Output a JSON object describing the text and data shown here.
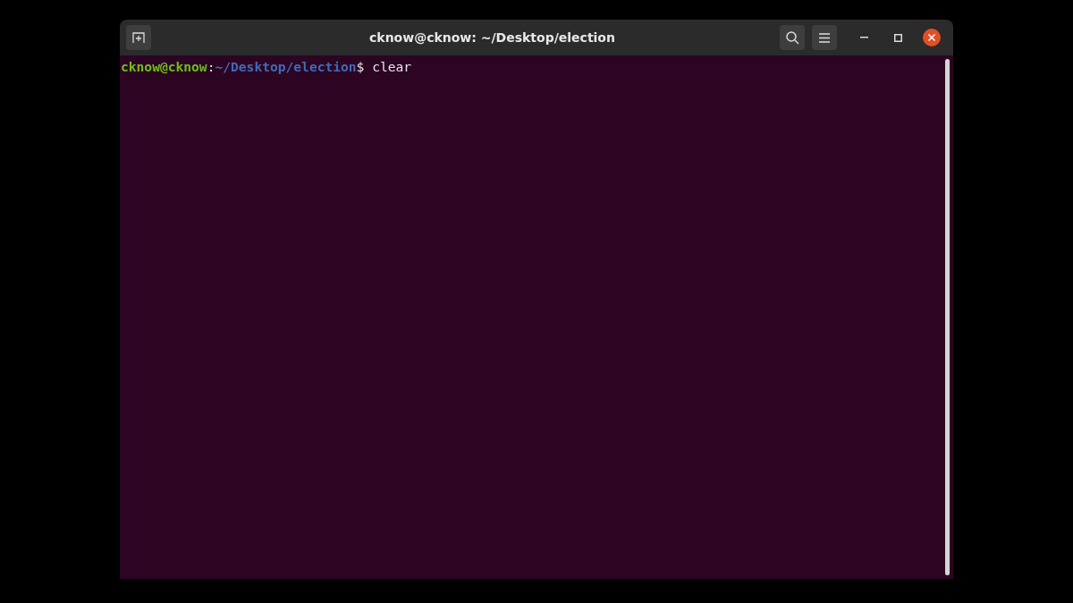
{
  "window": {
    "title": "cknow@cknow: ~/Desktop/election"
  },
  "terminal": {
    "lines": [
      {
        "user": "cknow@cknow",
        "separator": ":",
        "path": "~/Desktop/election",
        "symbol": "$",
        "command": "clear"
      }
    ]
  }
}
